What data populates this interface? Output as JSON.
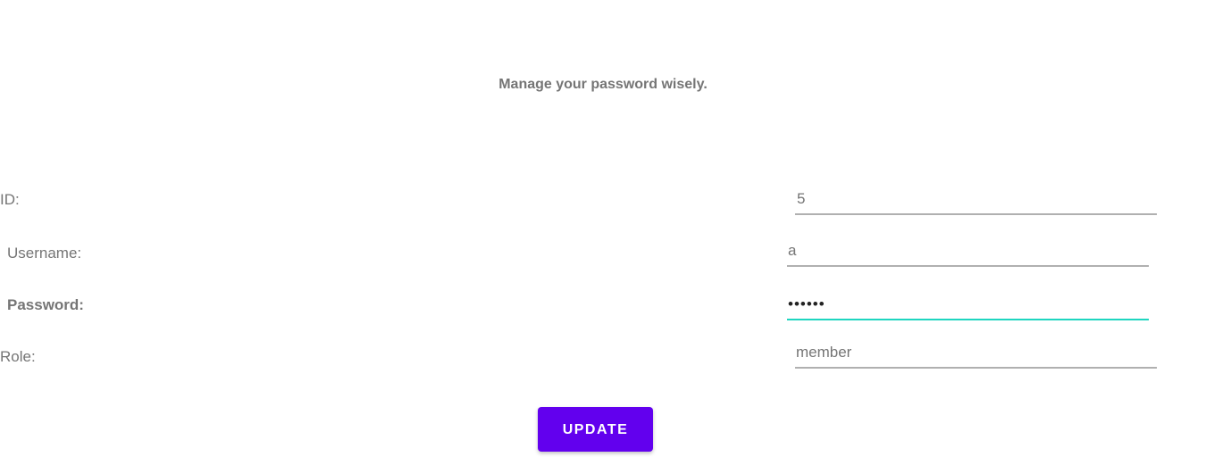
{
  "header": {
    "title": "Manage your password wisely."
  },
  "form": {
    "id": {
      "label": "ID:",
      "value": "5"
    },
    "username": {
      "label": "Username:",
      "value": "a"
    },
    "password": {
      "label": "Password:",
      "value": "••••••"
    },
    "role": {
      "label": "Role:",
      "value": "member"
    }
  },
  "actions": {
    "update_label": "UPDATE"
  },
  "colors": {
    "accent": "#6200ee",
    "focus_underline": "#1fd6c0",
    "label_text": "#757575",
    "underline": "#b0b0b0"
  }
}
